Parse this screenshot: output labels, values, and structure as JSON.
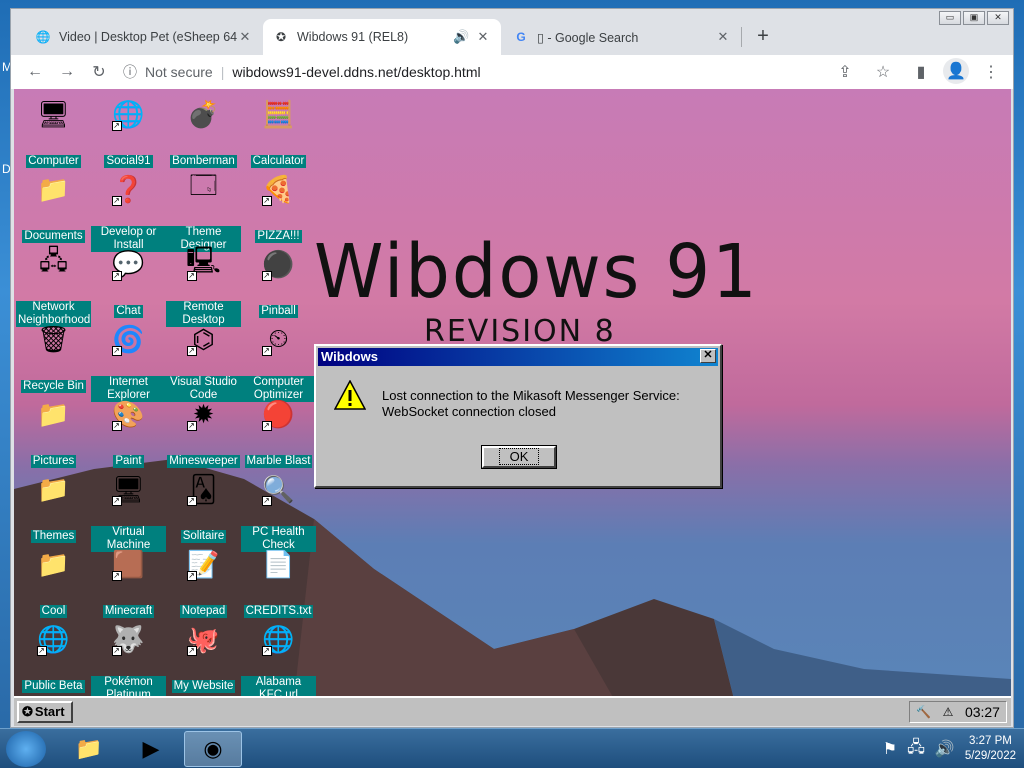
{
  "browser": {
    "tabs": [
      {
        "label": "Video | Desktop Pet (eSheep 64b",
        "favicon": "globe-icon",
        "active": false
      },
      {
        "label": "Wibdows 91 (REL8)",
        "favicon": "wibdows-icon",
        "active": true,
        "audio": true
      },
      {
        "label": "▯ - Google Search",
        "favicon": "google-icon",
        "active": false
      }
    ],
    "new_tab": "+",
    "window_controls": {
      "minimize": "▭",
      "maximize": "▣",
      "close": "✕"
    },
    "security_label": "Not secure",
    "url": "wibdows91-devel.ddns.net/desktop.html"
  },
  "wibdows": {
    "title": "Wibdows 91",
    "revision": "REVISION 8",
    "icons": [
      {
        "label": "Computer",
        "glyph": "🖥",
        "shortcut": false
      },
      {
        "label": "Social91",
        "glyph": "🌐",
        "shortcut": true
      },
      {
        "label": "Bomberman",
        "glyph": "💣",
        "shortcut": false
      },
      {
        "label": "Calculator",
        "glyph": "🧮",
        "shortcut": false
      },
      {
        "label": "Documents",
        "glyph": "📁",
        "shortcut": false
      },
      {
        "label": "Develop or Install",
        "glyph": "❓",
        "shortcut": true
      },
      {
        "label": "Theme Designer",
        "glyph": "🗔",
        "shortcut": false
      },
      {
        "label": "PIZZA!!!",
        "glyph": "🍕",
        "shortcut": true
      },
      {
        "label": "Network Neighborhood",
        "glyph": "🖧",
        "shortcut": false
      },
      {
        "label": "Chat",
        "glyph": "💬",
        "shortcut": true
      },
      {
        "label": "Remote Desktop",
        "glyph": "🖳",
        "shortcut": true
      },
      {
        "label": "Pinball",
        "glyph": "⚫",
        "shortcut": true
      },
      {
        "label": "Recycle Bin",
        "glyph": "🗑",
        "shortcut": false
      },
      {
        "label": "Internet Explorer",
        "glyph": "🌀",
        "shortcut": true
      },
      {
        "label": "Visual Studio Code",
        "glyph": "⌬",
        "shortcut": true
      },
      {
        "label": "Computer Optimizer",
        "glyph": "⏲",
        "shortcut": true
      },
      {
        "label": "Pictures",
        "glyph": "📁",
        "shortcut": false
      },
      {
        "label": "Paint",
        "glyph": "🎨",
        "shortcut": true
      },
      {
        "label": "Minesweeper",
        "glyph": "✹",
        "shortcut": true
      },
      {
        "label": "Marble Blast",
        "glyph": "🔴",
        "shortcut": true
      },
      {
        "label": "Themes",
        "glyph": "📁",
        "shortcut": false
      },
      {
        "label": "Virtual Machine",
        "glyph": "🖥",
        "shortcut": true
      },
      {
        "label": "Solitaire",
        "glyph": "🂡",
        "shortcut": true
      },
      {
        "label": "PC Health Check",
        "glyph": "🔍",
        "shortcut": true
      },
      {
        "label": "Cool",
        "glyph": "📁",
        "shortcut": false
      },
      {
        "label": "Minecraft",
        "glyph": "🟫",
        "shortcut": true
      },
      {
        "label": "Notepad",
        "glyph": "📝",
        "shortcut": true
      },
      {
        "label": "CREDITS.txt",
        "glyph": "📄",
        "shortcut": false
      },
      {
        "label": "Public Beta",
        "glyph": "🌐",
        "shortcut": true
      },
      {
        "label": "Pokémon Platinum",
        "glyph": "🐺",
        "shortcut": true
      },
      {
        "label": "My Website",
        "glyph": "🐙",
        "shortcut": true
      },
      {
        "label": "Alabama KFC.url",
        "glyph": "🌐",
        "shortcut": true
      }
    ],
    "dialog": {
      "title": "Wibdows",
      "close": "✕",
      "message_line1": "Lost connection to the Mikasoft Messenger Service:",
      "message_line2": "WebSocket connection closed",
      "ok": "OK"
    },
    "taskbar": {
      "start": "Start",
      "clock": "03:27"
    }
  },
  "win7": {
    "edge_letters": [
      "M",
      "D"
    ],
    "clock_time": "3:27 PM",
    "clock_date": "5/29/2022",
    "apps": [
      "folder-icon",
      "media-player-icon",
      "chrome-icon"
    ]
  },
  "colors": {
    "icon_label_bg": "#00807e",
    "dialog_title_start": "#000080",
    "dialog_title_end": "#1084d0"
  }
}
